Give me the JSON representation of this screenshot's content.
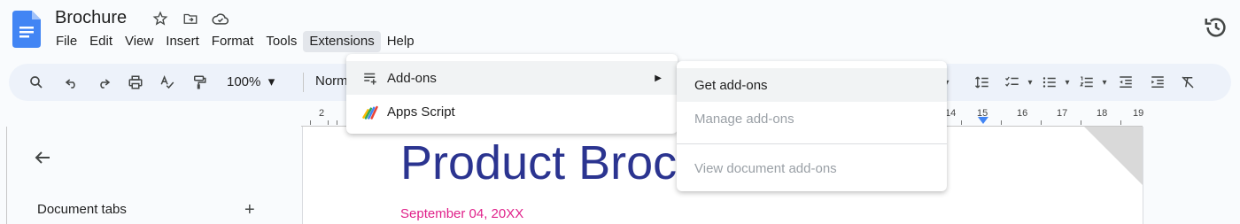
{
  "app": {
    "doc_title": "Brochure"
  },
  "menubar": [
    "File",
    "Edit",
    "View",
    "Insert",
    "Format",
    "Tools",
    "Extensions",
    "Help"
  ],
  "toolbar": {
    "zoom": "100%",
    "style": "Norm"
  },
  "ruler": {
    "left_numbers": [
      "2"
    ],
    "right_numbers": [
      "14",
      "15",
      "16",
      "17",
      "18",
      "19"
    ]
  },
  "sidebar": {
    "tabs_label": "Document tabs",
    "add_symbol": "+"
  },
  "document": {
    "heading": "Product Broch",
    "date": "September 04, 20XX"
  },
  "extensions_menu": {
    "items": [
      {
        "label": "Add-ons",
        "icon": "add-ons-icon",
        "has_submenu": true
      },
      {
        "label": "Apps Script",
        "icon": "apps-script-icon",
        "has_submenu": false
      }
    ]
  },
  "addons_submenu": {
    "items": [
      {
        "label": "Get add-ons",
        "enabled": true
      },
      {
        "label": "Manage add-ons",
        "enabled": false
      },
      {
        "label": "View document add-ons",
        "enabled": false
      }
    ]
  },
  "colors": {
    "heading": "#2b3490",
    "date": "#e0218a",
    "doc_icon": "#4285f4",
    "toolbar_bg": "#edf2fa"
  }
}
